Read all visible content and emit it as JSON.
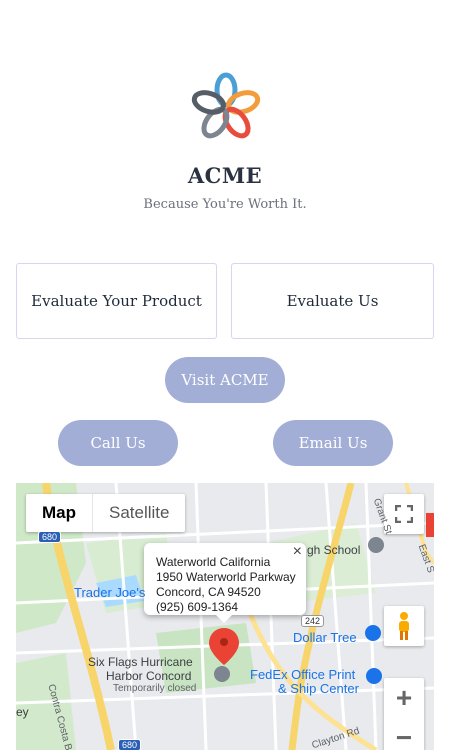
{
  "brand": {
    "name": "ACME",
    "tagline": "Because You're Worth It.",
    "logo_icon": "flower-logo-icon",
    "colors": {
      "blue": "#4a9fd4",
      "orange": "#f39c3b",
      "red": "#e74c3c",
      "gray": "#7c8590",
      "accent": "#a2aed6"
    }
  },
  "cards": [
    {
      "label": "Evaluate Your Product"
    },
    {
      "label": "Evaluate Us"
    }
  ],
  "buttons": {
    "visit": "Visit ACME",
    "call": "Call Us",
    "email": "Email Us"
  },
  "map": {
    "type_options": [
      "Map",
      "Satellite"
    ],
    "selected_type": "Map",
    "info": {
      "name": "Waterworld California",
      "address1": "1950 Waterworld Parkway",
      "address2": "Concord, CA 94520",
      "phone": "(925) 609-1364",
      "close": "×"
    },
    "labels": {
      "trader_joes": "Trader Joe's",
      "school": "gh School",
      "dollar_tree": "Dollar Tree",
      "six_flags_1": "Six Flags Hurricane",
      "six_flags_2": "Harbor Concord",
      "temp_closed": "Temporarily closed",
      "fedex_1": "FedEx Office Print",
      "fedex_2": "& Ship Center",
      "contra_costa": "Contra Costa Blvd",
      "clayton": "Clayton Rd",
      "grant": "Grant St",
      "east": "East S",
      "ey": "ey",
      "route_680_a": "680",
      "route_680_b": "680",
      "route_242": "242"
    },
    "zoom_in": "+",
    "zoom_out": "−"
  }
}
